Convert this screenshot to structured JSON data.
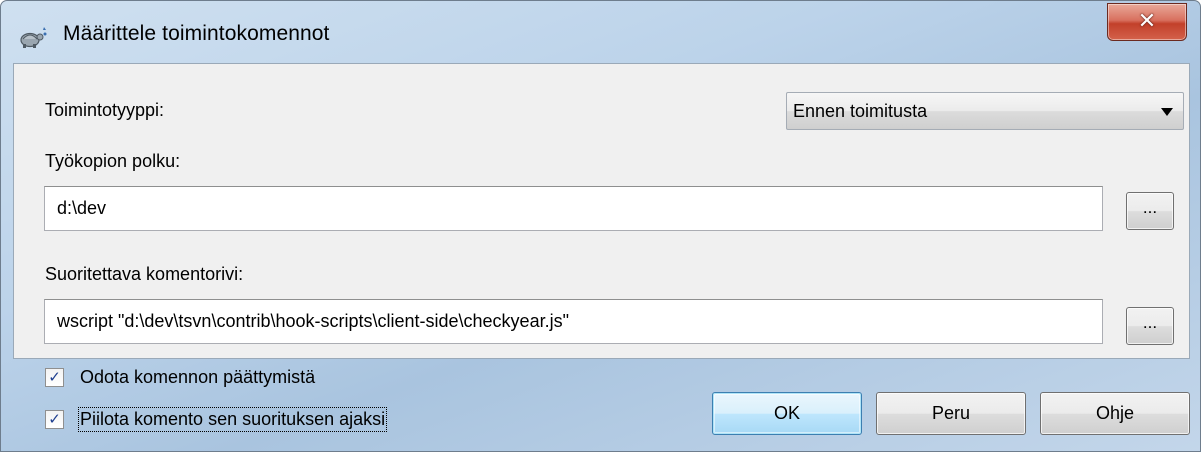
{
  "window": {
    "title": "Määrittele toimintokomennot",
    "close_glyph": "✕"
  },
  "form": {
    "action_type_label": "Toimintotyyppi:",
    "action_type_value": "Ennen toimitusta",
    "working_copy_label": "Työkopion polku:",
    "working_copy_value": "d:\\dev",
    "command_line_label": "Suoritettava komentorivi:",
    "command_line_value": "wscript \"d:\\dev\\tsvn\\contrib\\hook-scripts\\client-side\\checkyear.js\"",
    "browse_label": "..."
  },
  "options": {
    "wait_label": "Odota komennon päättymistä",
    "wait_checked": true,
    "hide_label": "Piilota komento sen suorituksen ajaksi",
    "hide_checked": true,
    "check_glyph": "✓"
  },
  "buttons": {
    "ok": "OK",
    "cancel": "Peru",
    "help": "Ohje"
  },
  "icons": {
    "window_icon": "tortoise-hook-icon",
    "close": "close-icon",
    "dropdown": "chevron-down-icon"
  }
}
